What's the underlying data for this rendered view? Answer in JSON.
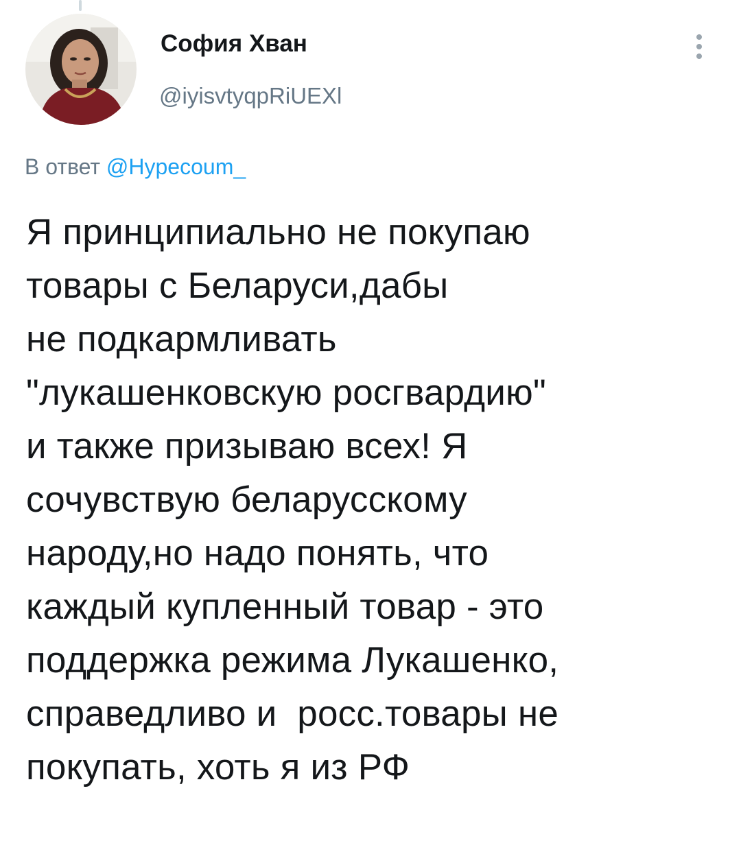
{
  "tweet": {
    "author": {
      "display_name": "София Хван",
      "handle": "@iyisvtyqpRiUEXl"
    },
    "reply_to": {
      "prefix": "В ответ",
      "mention": "@Hypecoum_"
    },
    "text_lines": [
      "Я принципиально не покупаю",
      "товары с Беларуси,дабы",
      "не подкармливать",
      "\"лукашенковскую росгвардию\"",
      "и также призываю всех! Я",
      "сочувствую беларусскому",
      "народу,но надо понять, что",
      "каждый купленный товар - это",
      "поддержка режима Лукашенко,",
      "справедливо и  росс.товары не",
      "покупать, хоть я из РФ"
    ]
  },
  "icons": {
    "more": "more-vertical-icon",
    "avatar": "profile-photo"
  },
  "colors": {
    "text": "#14171a",
    "secondary": "#657786",
    "link": "#1da1f2",
    "thread_line": "#cfd9de"
  }
}
